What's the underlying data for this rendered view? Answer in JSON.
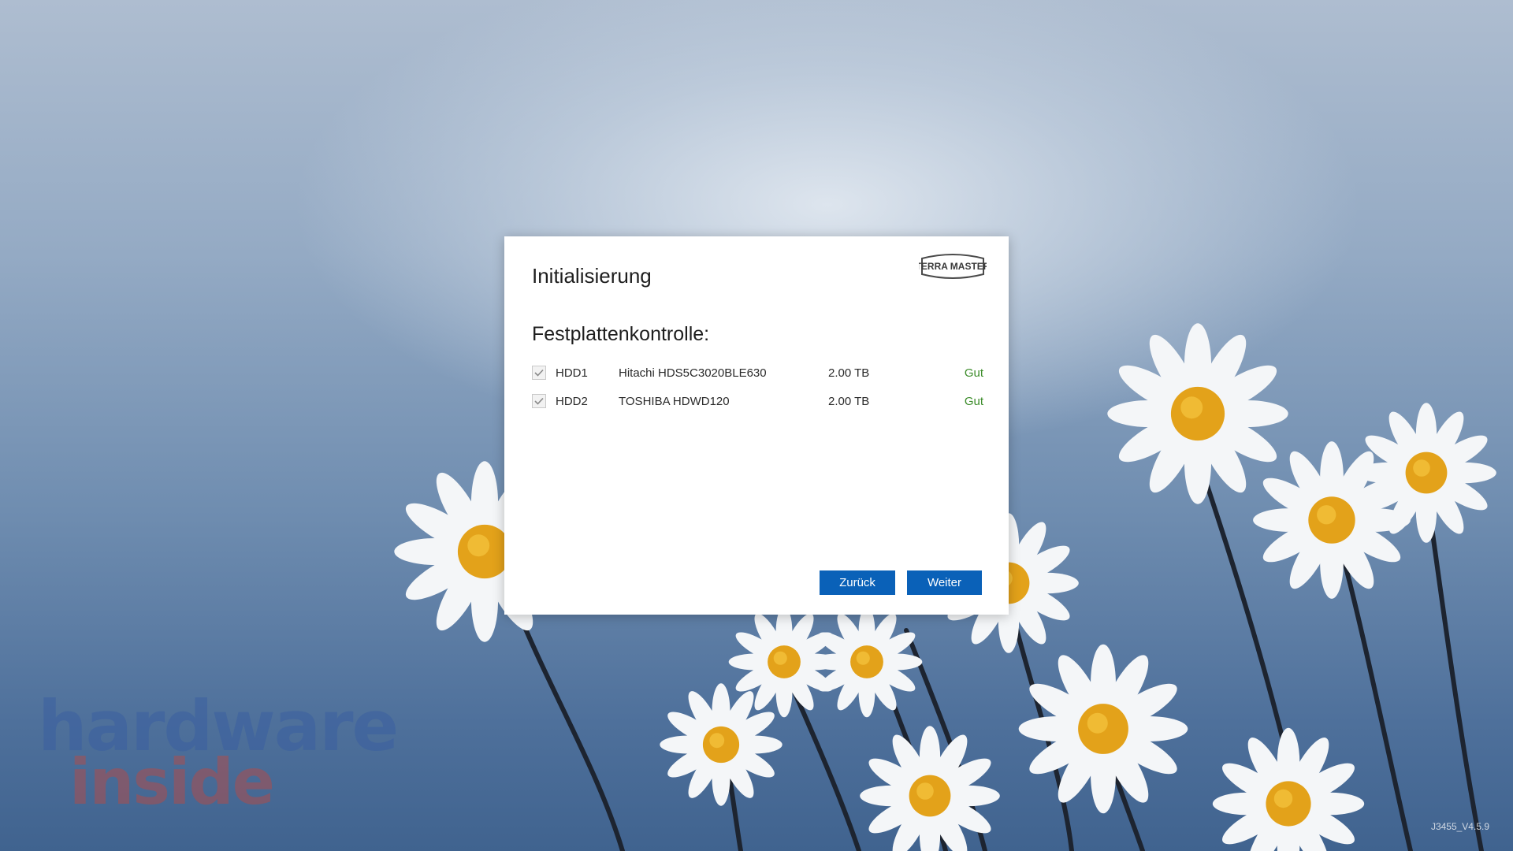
{
  "dialog": {
    "title": "Initialisierung",
    "brand": "TERRA MASTER",
    "section_heading": "Festplattenkontrolle:",
    "disks": [
      {
        "checked": true,
        "slot": "HDD1",
        "model": "Hitachi HDS5C3020BLE630",
        "size": "2.00 TB",
        "status": "Gut"
      },
      {
        "checked": true,
        "slot": "HDD2",
        "model": "TOSHIBA HDWD120",
        "size": "2.00 TB",
        "status": "Gut"
      }
    ],
    "back_label": "Zurück",
    "next_label": "Weiter"
  },
  "watermark": {
    "line1": "hardware",
    "line2": "inside"
  },
  "version": "J3455_V4.5.9",
  "colors": {
    "button": "#0a61b8",
    "status_good": "#3c8c2a",
    "watermark_red": "#c0463f",
    "watermark_blue": "#3a5fa0"
  }
}
